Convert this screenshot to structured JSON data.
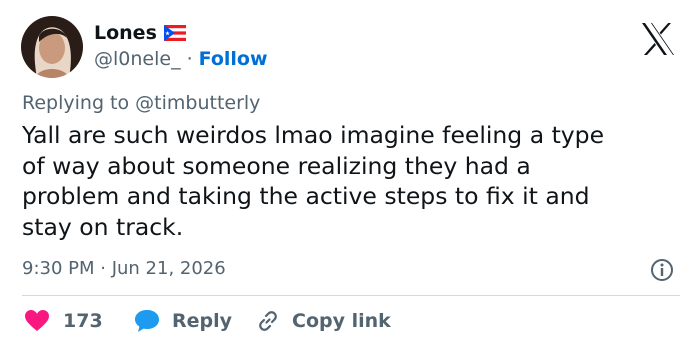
{
  "user": {
    "display_name": "Lones",
    "handle": "@l0nele_",
    "separator": "·",
    "follow_label": "Follow"
  },
  "reply_to": "Replying to @timbutterly",
  "tweet": {
    "text": "Yall are such weirdos lmao imagine feeling a type\nof way about someone realizing they had a\nproblem and taking the active steps to fix it and\nstay on track."
  },
  "timestamp": "9:30 PM · Jun 21, 2026",
  "actions": {
    "like_count": "173",
    "reply_label": "Reply",
    "copy_link_label": "Copy link"
  },
  "colors": {
    "like": "#f91880",
    "reply": "#1d9bf0",
    "follow": "#006fd6",
    "muted": "#536471",
    "text": "#0f1419"
  },
  "icons": [
    "avatar",
    "puerto-rico-flag-icon",
    "x-logo-icon",
    "info-icon",
    "heart-icon",
    "reply-bubble-icon",
    "link-icon"
  ]
}
